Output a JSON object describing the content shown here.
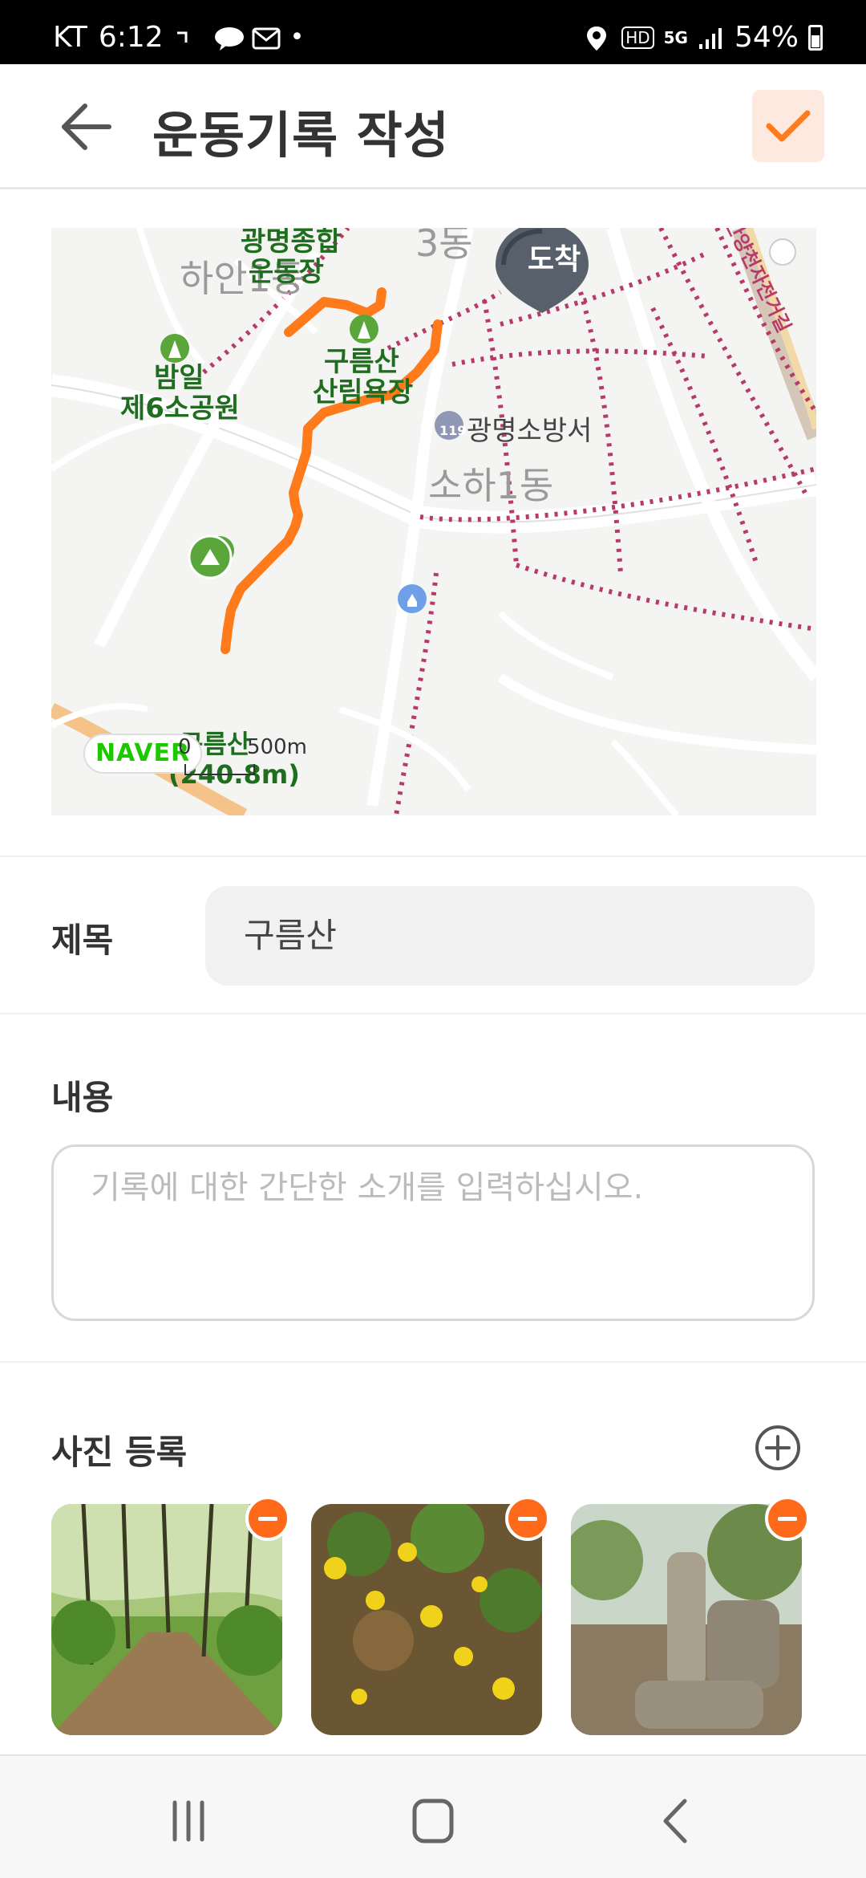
{
  "status_bar": {
    "carrier": "KT",
    "time": "6:12",
    "network_hd": "HD",
    "network_5g": "5G",
    "battery": "54%"
  },
  "header": {
    "title": "운동기록 작성",
    "back_icon": "arrow-left-icon",
    "confirm_icon": "check-icon",
    "accent_color": "#ff7a1a"
  },
  "map": {
    "arrive_label": "도착",
    "start_label": "구름산",
    "start_elevation": "(240.8m)",
    "naver_logo": "NAVER",
    "scale_start": "0",
    "scale_end": "500m",
    "places": {
      "hagan1": "하안1동",
      "gwangmyeong_stadium_line1": "광명종합",
      "gwangmyeong_stadium_line2": "운동장",
      "bamil_line1": "밤일",
      "bamil_line2": "제6소공원",
      "gureumsan_forest_line1": "구름산",
      "gureumsan_forest_line2": "산림욕장",
      "fire_station": "광명소방서",
      "soha1": "소하1동",
      "dong3": "3동",
      "road": "안양천자전거길",
      "fire_badge": "119"
    }
  },
  "form": {
    "title_label": "제목",
    "title_value": "구름산",
    "content_label": "내용",
    "content_placeholder": "기록에 대한 간단한 소개를 입력하십시오.",
    "photo_label": "사진 등록"
  },
  "photos": [
    {
      "alt": "forest-trail-photo"
    },
    {
      "alt": "yellow-flowers-photo"
    },
    {
      "alt": "summit-stone-photo"
    }
  ]
}
